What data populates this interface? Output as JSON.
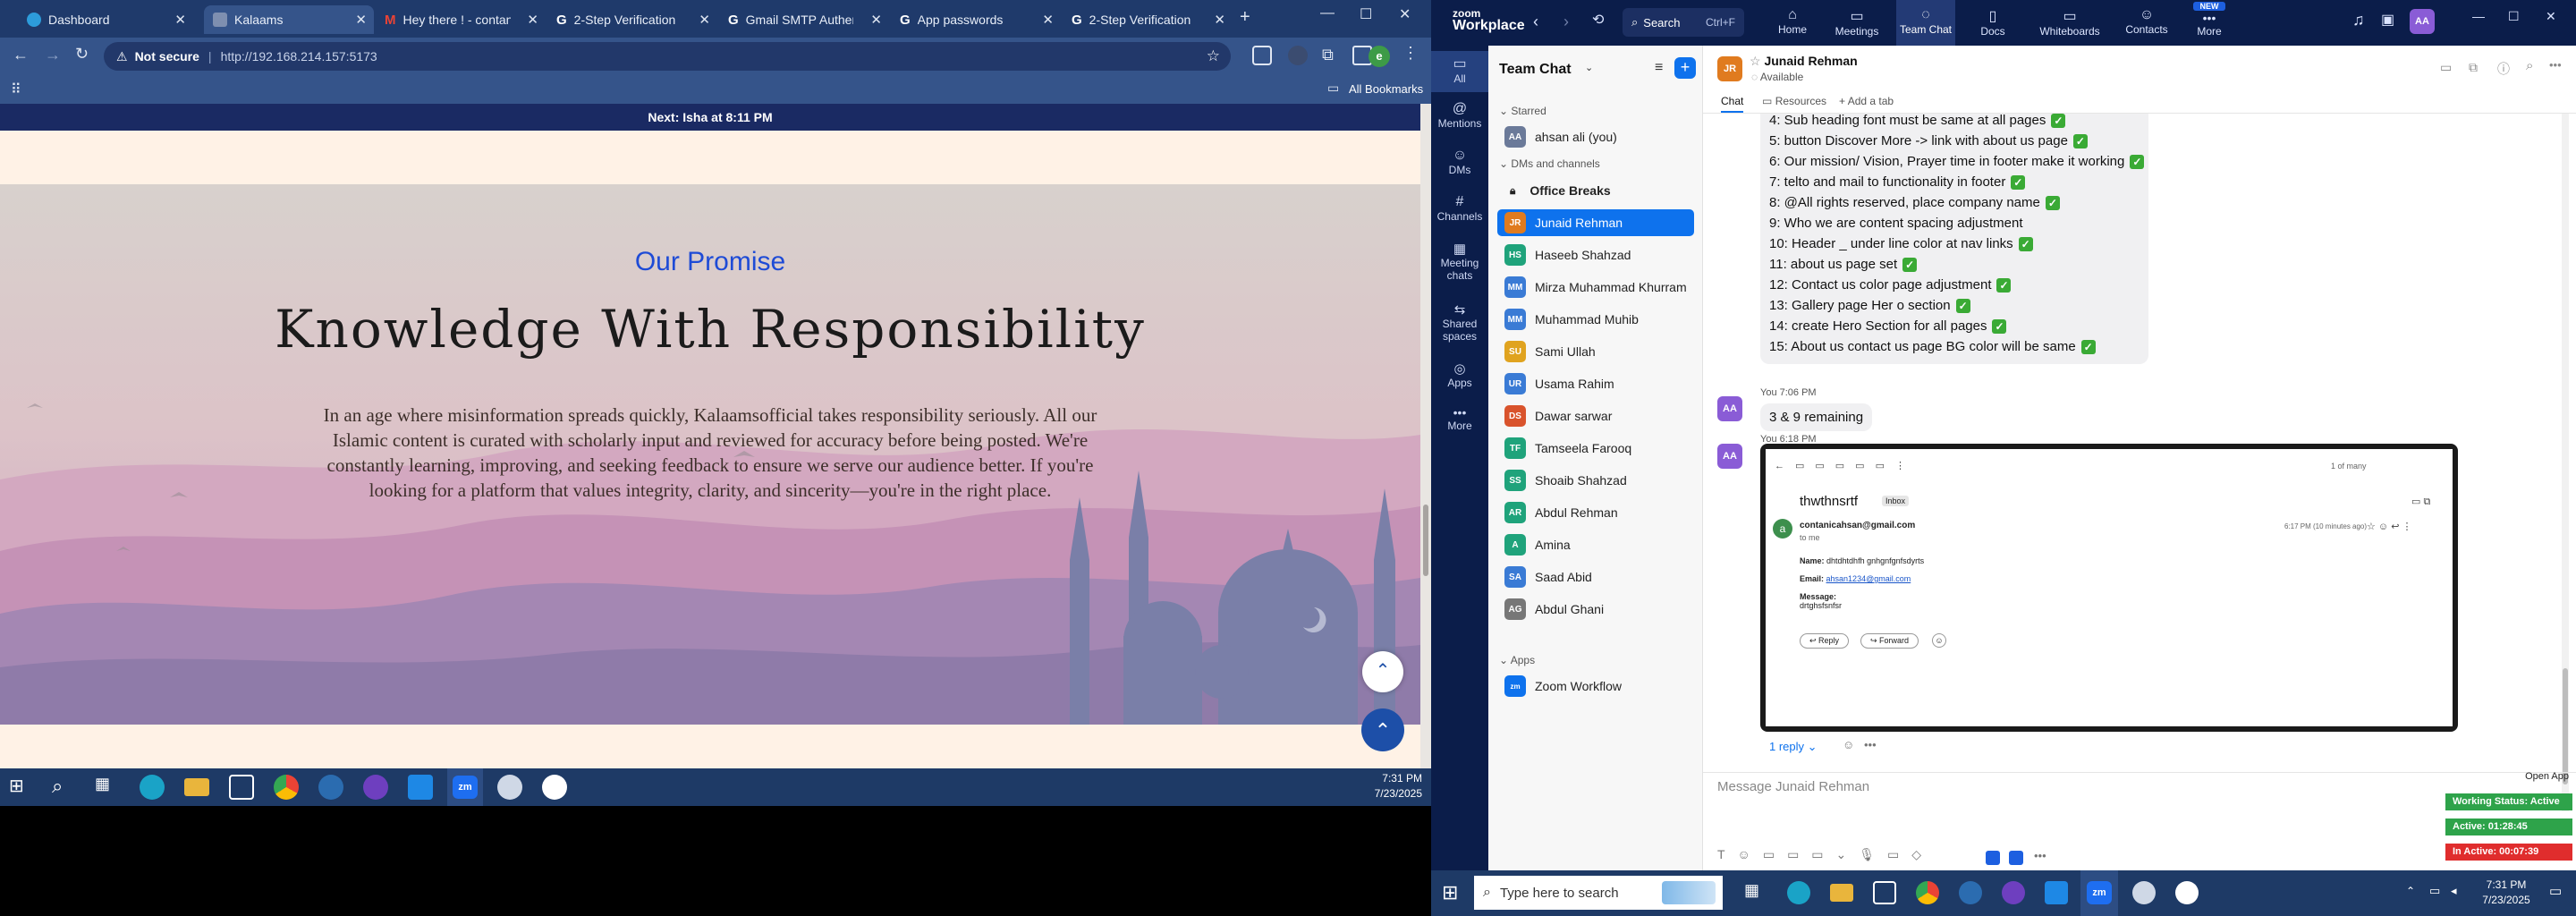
{
  "browser": {
    "tabs": [
      {
        "title": "Dashboard",
        "icon_color": "#2d9cdb"
      },
      {
        "title": "Kalaams",
        "icon_color": "#5b6b8a"
      },
      {
        "title": "Hey there ! - contanic",
        "icon_color": "#ea4335"
      },
      {
        "title": "2-Step Verification",
        "icon_color": "#ffffff"
      },
      {
        "title": "Gmail SMTP Authentic",
        "icon_color": "#ffffff"
      },
      {
        "title": "App passwords",
        "icon_color": "#ffffff"
      },
      {
        "title": "2-Step Verification",
        "icon_color": "#ffffff"
      }
    ],
    "security_label": "Not secure",
    "url": "http://192.168.214.157:5173",
    "bookmarks_label": "All Bookmarks",
    "profile_initial": "e"
  },
  "website": {
    "banner": "Next: Isha at 8:11 PM",
    "section_label": "Our Promise",
    "heading": "Knowledge With Responsibility",
    "paragraph": "In an age where misinformation spreads quickly, Kalaamsofficial takes responsibility seriously. All our Islamic content is curated with scholarly input and reviewed for accuracy before being posted. We're constantly learning, improving, and seeking feedback to ensure we serve our audience better. If you're looking for a platform that values integrity, clarity, and sincerity—you're in the right place.",
    "label_color": "#1e4bd6"
  },
  "taskbar_left": {
    "time": "7:31 PM",
    "date": "7/23/2025"
  },
  "zoom": {
    "brand_top": "zoom",
    "brand_bottom": "Workplace",
    "search_label": "Search",
    "search_shortcut": "Ctrl+F",
    "nav": [
      {
        "label": "Home"
      },
      {
        "label": "Meetings"
      },
      {
        "label": "Team Chat"
      },
      {
        "label": "Docs"
      },
      {
        "label": "Whiteboards"
      },
      {
        "label": "Contacts"
      },
      {
        "label": "More",
        "badge": "NEW"
      }
    ],
    "avatar_initials": "AA",
    "rail": [
      {
        "label": "All"
      },
      {
        "label": "Mentions"
      },
      {
        "label": "DMs"
      },
      {
        "label": "Channels"
      },
      {
        "label": "Meeting chats"
      },
      {
        "label": "Shared spaces"
      },
      {
        "label": "Apps"
      },
      {
        "label": "More"
      }
    ],
    "list_title": "Team Chat",
    "starred_label": "Starred",
    "self_contact": {
      "initials": "AA",
      "name": "ahsan ali (you)",
      "color": "#6b7a99"
    },
    "dms_label": "DMs and channels",
    "channel": "Office Breaks",
    "contacts": [
      {
        "initials": "JR",
        "name": "Junaid Rehman",
        "color": "#e07b1f"
      },
      {
        "initials": "HS",
        "name": "Haseeb Shahzad",
        "color": "#1fa37b"
      },
      {
        "initials": "MM",
        "name": "Mirza Muhammad Khurram",
        "color": "#3a7bd5"
      },
      {
        "initials": "MM",
        "name": "Muhammad Muhib",
        "color": "#3a7bd5"
      },
      {
        "initials": "SU",
        "name": "Sami Ullah",
        "color": "#e0a31f"
      },
      {
        "initials": "UR",
        "name": "Usama Rahim",
        "color": "#3a7bd5"
      },
      {
        "initials": "DS",
        "name": "Dawar sarwar",
        "color": "#d9532c"
      },
      {
        "initials": "TF",
        "name": "Tamseela Farooq",
        "color": "#1fa37b"
      },
      {
        "initials": "SS",
        "name": "Shoaib Shahzad",
        "color": "#1fa37b"
      },
      {
        "initials": "AR",
        "name": "Abdul Rehman",
        "color": "#1fa37b"
      },
      {
        "initials": "A",
        "name": "Amina",
        "color": "#1fa37b"
      },
      {
        "initials": "SA",
        "name": "Saad Abid",
        "color": "#3a7bd5"
      },
      {
        "initials": "AG",
        "name": "Abdul Ghani",
        "color": "#777777"
      }
    ],
    "apps_label": "Apps",
    "app_name": "Zoom Workflow",
    "chat_header": {
      "initials": "JR",
      "name": "Junaid Rehman",
      "status": "Available"
    },
    "chat_tabs": [
      "Chat",
      "Resources",
      "Add a tab"
    ],
    "checklist": [
      {
        "text": "4: Sub heading font must be same at all pages",
        "done": true
      },
      {
        "text": "5: button Discover More -> link with  about us page",
        "done": true
      },
      {
        "text": "6: Our mission/ Vision, Prayer time in footer make it working",
        "done": true
      },
      {
        "text": "7: telto and mail to functionality in footer",
        "done": true
      },
      {
        "text": "8: @All rights reserved, place company name",
        "done": true
      },
      {
        "text": "9: Who we are content spacing adjustment",
        "done": false
      },
      {
        "text": "10: Header _ under line color at nav links",
        "done": true
      },
      {
        "text": "11: about us page set",
        "done": true
      },
      {
        "text": "12: Contact us color page adjustment",
        "done": true
      },
      {
        "text": "13: Gallery page Her o section",
        "done": true
      },
      {
        "text": "14: create Hero Section for all pages",
        "done": true
      },
      {
        "text": "15: About us contact us page BG color will be same",
        "done": true
      }
    ],
    "msg2_time": "You 7:06 PM",
    "msg2_text": "3 & 9 remaining",
    "msg3_time": "You 6:18 PM",
    "email": {
      "subject": "thwthnsrtf",
      "inbox_tag": "Inbox",
      "sender": "contanicahsan@gmail.com",
      "to_me": "to me",
      "time": "6:17 PM (10 minutes ago)",
      "counter": "1 of many",
      "name_label": "Name:",
      "name_value": "dhtdhtdhfh gnhgnfgnfsdyrts",
      "email_label": "Email:",
      "email_value": "ahsan1234@gmail.com",
      "message_label": "Message:",
      "message_value": "drtghsfsnfsr",
      "reply_label": "Reply",
      "forward_label": "Forward"
    },
    "reply_count": "1 reply",
    "composer_placeholder": "Message Junaid Rehman",
    "open_app": "Open App",
    "working_status": "Working Status: Active",
    "active_time": "Active: 01:28:45",
    "inactive_time": "In Active: 00:07:39",
    "taskbar_search": "Type here to search",
    "time": "7:31 PM",
    "date": "7/23/2025"
  }
}
